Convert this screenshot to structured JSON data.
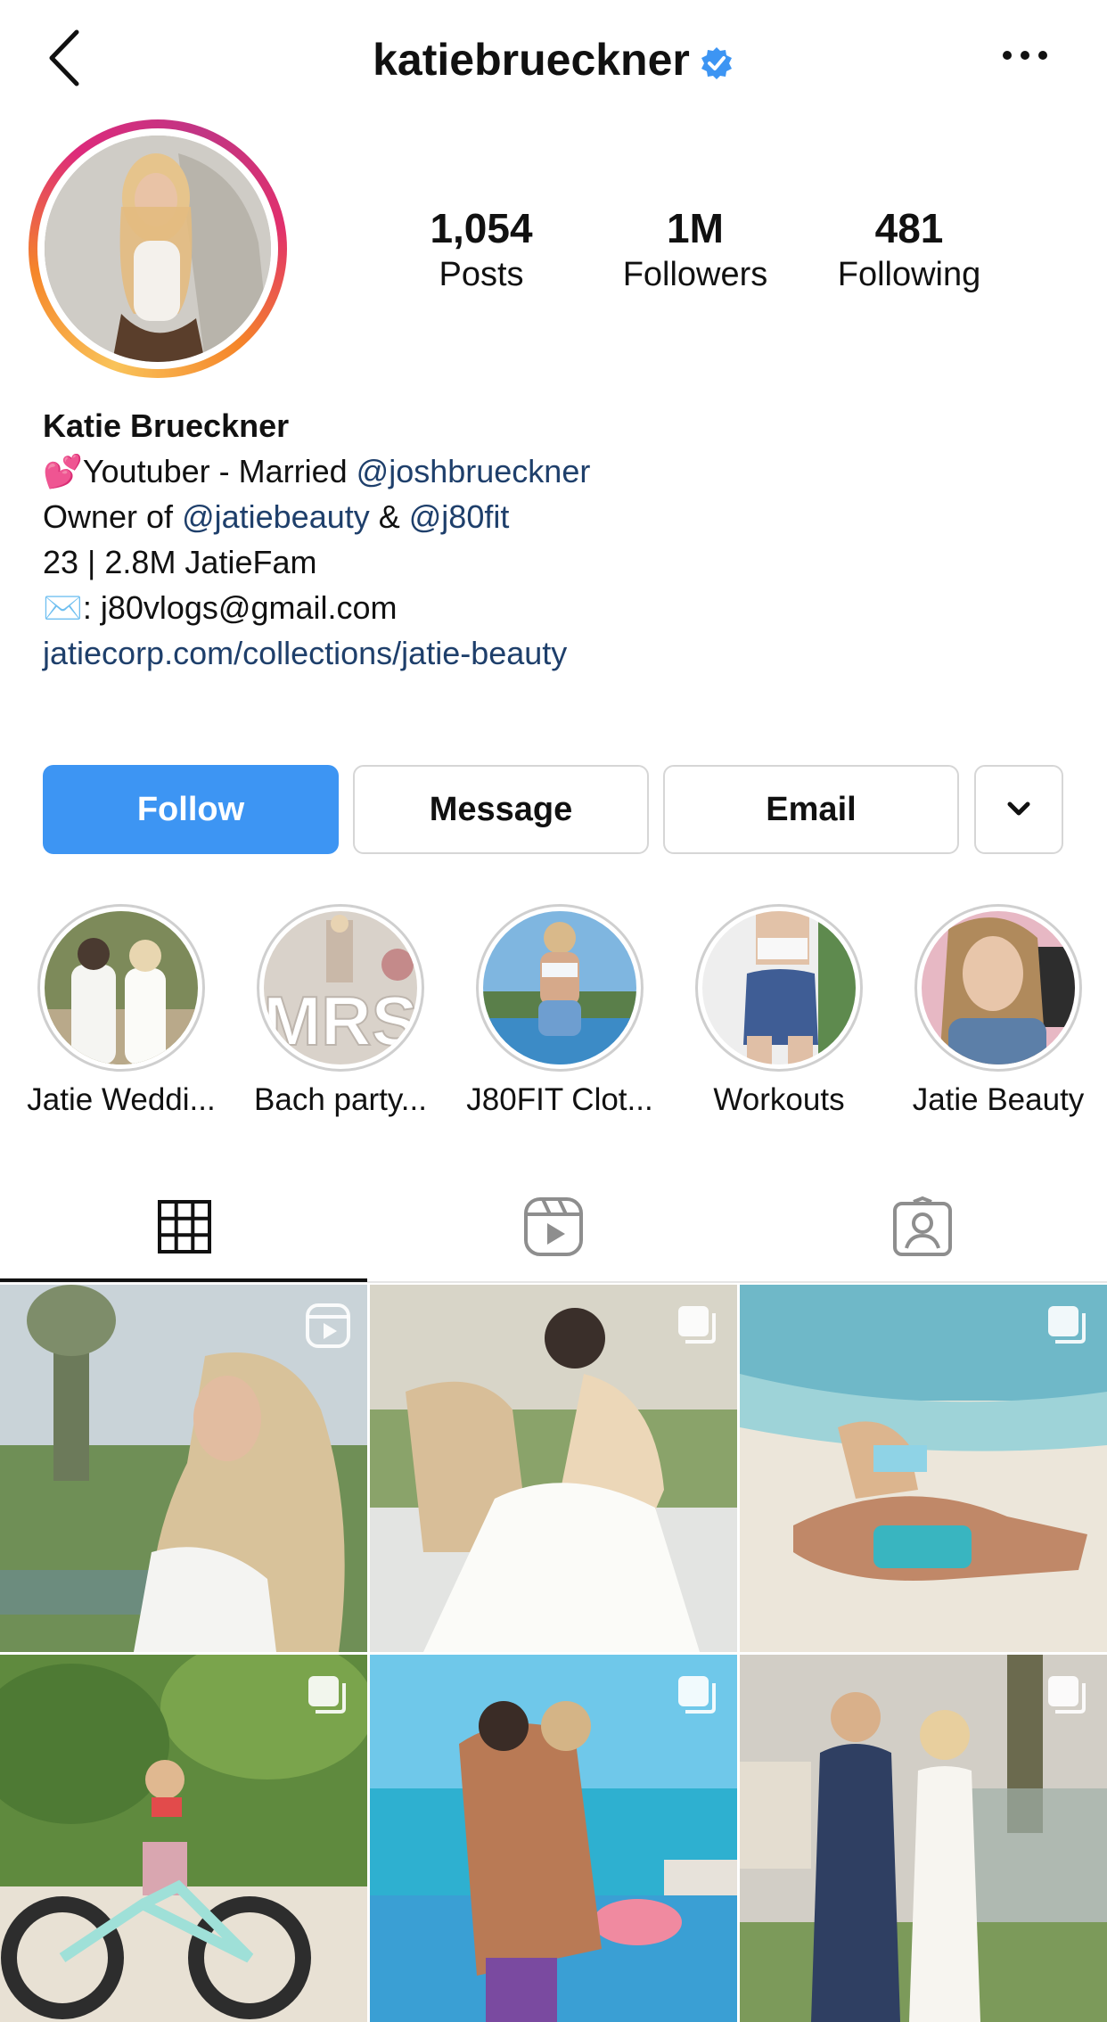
{
  "header": {
    "username": "katiebrueckner",
    "back_icon": "chevron-left-icon",
    "verified_icon": "verified-badge-icon",
    "more_icon": "ellipsis-icon"
  },
  "stats": [
    {
      "value": "1,054",
      "label": "Posts"
    },
    {
      "value": "1M",
      "label": "Followers"
    },
    {
      "value": "481",
      "label": "Following"
    }
  ],
  "bio": {
    "name": "Katie Brueckner",
    "line1_emoji": "💕",
    "line1_text": "Youtuber - Married ",
    "line1_mention": "@joshbrueckner",
    "line2_prefix": "Owner of ",
    "line2_mention1": "@jatiebeauty",
    "line2_and": " & ",
    "line2_mention2": "@j80fit",
    "line3": "23 | 2.8M JatieFam",
    "line4_emoji": "✉️",
    "line4_text": ": j80vlogs@gmail.com",
    "website": "jatiecorp.com/collections/jatie-beauty"
  },
  "buttons": {
    "follow": "Follow",
    "message": "Message",
    "email": "Email",
    "more_icon": "chevron-down-icon"
  },
  "highlights": [
    {
      "label": "Jatie Weddi..."
    },
    {
      "label": "Bach party..."
    },
    {
      "label": "J80FIT Clot..."
    },
    {
      "label": "Workouts"
    },
    {
      "label": "Jatie Beauty"
    }
  ],
  "highlight_overlay_text": "MRS",
  "tabs": [
    {
      "name": "grid",
      "icon": "grid-icon",
      "selected": true
    },
    {
      "name": "reels",
      "icon": "reels-icon",
      "selected": false
    },
    {
      "name": "tagged",
      "icon": "tagged-person-icon",
      "selected": false
    }
  ],
  "posts": [
    {
      "badge": "reel-icon"
    },
    {
      "badge": "carousel-icon"
    },
    {
      "badge": "carousel-icon"
    },
    {
      "badge": "carousel-icon"
    },
    {
      "badge": "carousel-icon"
    },
    {
      "badge": "carousel-icon"
    }
  ],
  "colors": {
    "follow_button": "#3d95f3",
    "link": "#1e3f6b",
    "verified": "#3d95f3"
  }
}
